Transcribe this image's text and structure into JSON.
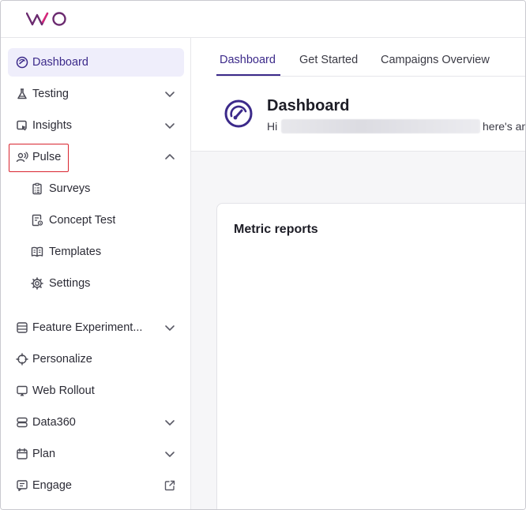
{
  "brand": {
    "logo_text": "VWO",
    "accent": "#3c2a8a",
    "logo_color": "#6b2a6f"
  },
  "sidebar": {
    "items": [
      {
        "label": "Dashboard",
        "icon": "gauge-icon",
        "active": true
      },
      {
        "label": "Testing",
        "icon": "flask-icon",
        "chevron": "down"
      },
      {
        "label": "Insights",
        "icon": "insights-icon",
        "chevron": "down"
      },
      {
        "label": "Pulse",
        "icon": "pulse-user-icon",
        "chevron": "up",
        "highlighted": true
      },
      {
        "label": "Surveys",
        "icon": "clipboard-icon",
        "sub": true
      },
      {
        "label": "Concept Test",
        "icon": "concept-test-icon",
        "sub": true
      },
      {
        "label": "Templates",
        "icon": "book-icon",
        "sub": true
      },
      {
        "label": "Settings",
        "icon": "gear-icon",
        "sub": true
      },
      {
        "label": "Feature Experiment...",
        "icon": "feature-icon",
        "chevron": "down"
      },
      {
        "label": "Personalize",
        "icon": "crosshair-icon"
      },
      {
        "label": "Web Rollout",
        "icon": "rollout-icon"
      },
      {
        "label": "Data360",
        "icon": "database-icon",
        "chevron": "down"
      },
      {
        "label": "Plan",
        "icon": "calendar-icon",
        "chevron": "down"
      },
      {
        "label": "Engage",
        "icon": "engage-icon",
        "external": true
      }
    ]
  },
  "tabs": [
    {
      "label": "Dashboard",
      "active": true
    },
    {
      "label": "Get Started"
    },
    {
      "label": "Campaigns Overview"
    }
  ],
  "header": {
    "title": "Dashboard",
    "greeting_prefix": "Hi",
    "greeting_suffix": "here's an"
  },
  "card": {
    "title": "Metric reports"
  }
}
